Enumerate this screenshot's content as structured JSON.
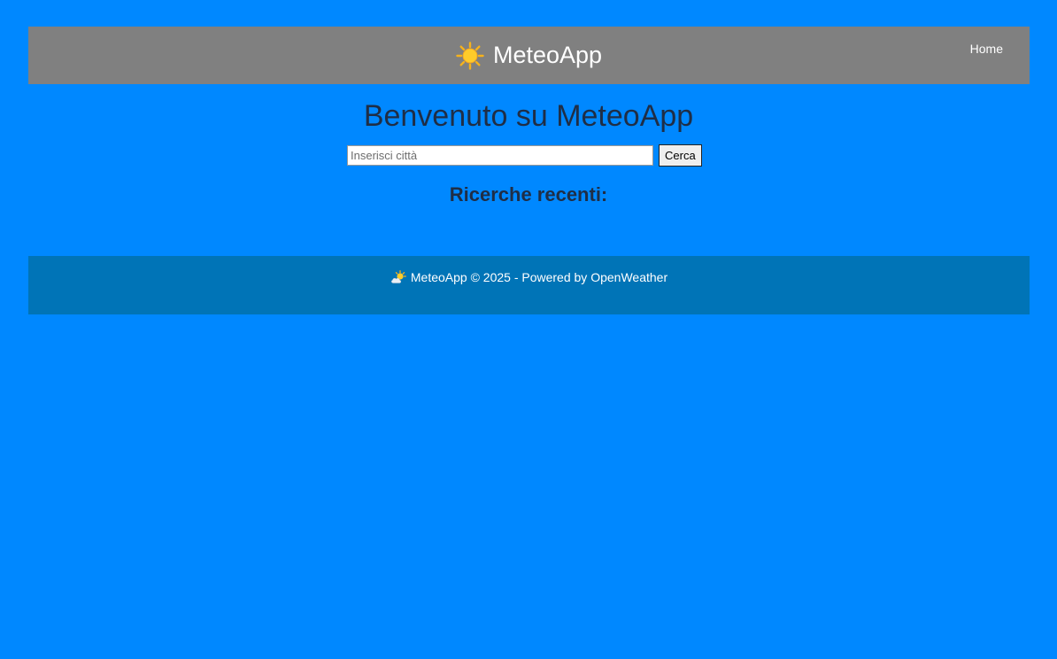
{
  "header": {
    "brand_icon": "sun-icon",
    "brand_title": "MeteoApp",
    "nav_home": "Home",
    "background": "#808080"
  },
  "main": {
    "heading": "Benvenuto su MeteoApp",
    "search": {
      "placeholder": "Inserisci città",
      "value": "",
      "button_label": "Cerca"
    },
    "recent_heading": "Ricerche recenti:"
  },
  "footer": {
    "icon": "sun-behind-cloud-icon",
    "text": "MeteoApp © 2025 - Powered by OpenWeather",
    "background": "#0074b7"
  },
  "colors": {
    "page_background": "#0088ff",
    "heading_text": "#1f2e46"
  }
}
